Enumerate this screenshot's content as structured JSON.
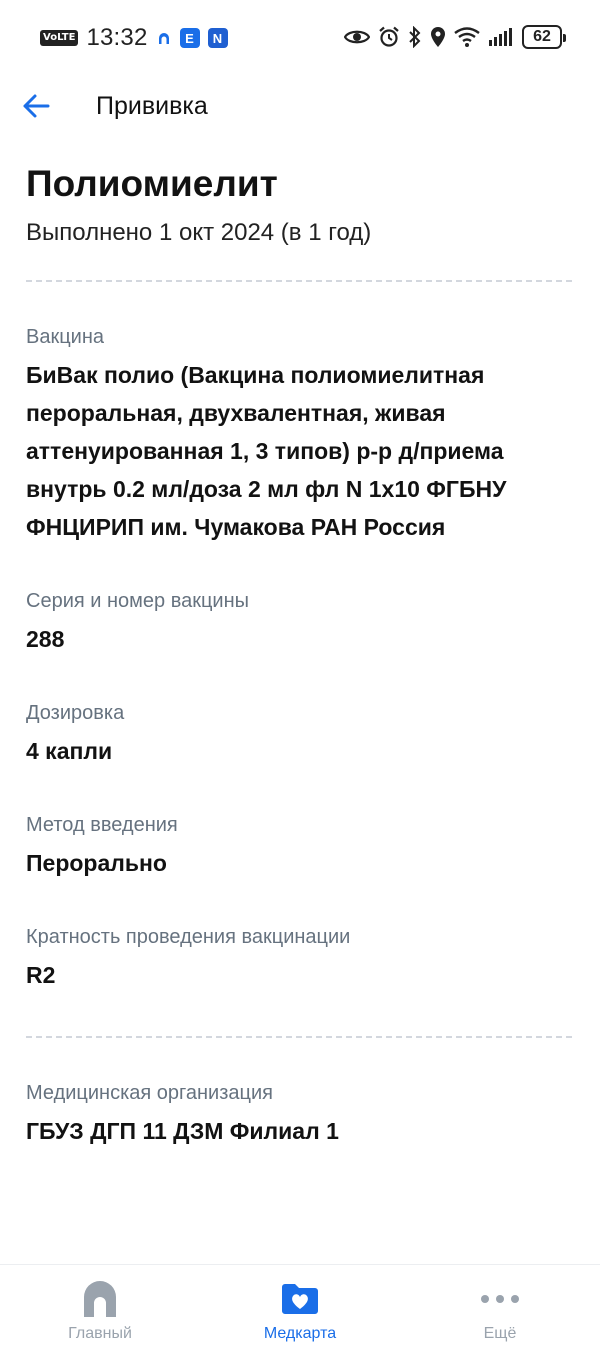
{
  "status_bar": {
    "volte": "VoLTE",
    "time": "13:32",
    "app_e": "E",
    "app_n": "N",
    "battery": "62"
  },
  "topbar": {
    "title": "Прививка"
  },
  "vaccination": {
    "title": "Полиомиелит",
    "subtitle": "Выполнено 1 окт 2024 (в 1 год)",
    "fields": [
      {
        "label": "Вакцина",
        "value": "БиВак полио (Вакцина полиомиелитная пероральная, двухвалентная, живая аттенуированная 1, 3 типов) р-р д/приема внутрь 0.2 мл/доза 2 мл фл N 1x10 ФГБНУ ФНЦИРИП им. Чумакова РАН Россия"
      },
      {
        "label": "Серия и номер вакцины",
        "value": "288"
      },
      {
        "label": "Дозировка",
        "value": "4 капли"
      },
      {
        "label": "Метод введения",
        "value": "Перорально"
      },
      {
        "label": "Кратность проведения вакцинации",
        "value": "R2"
      }
    ],
    "organization": {
      "label": "Медицинская организация",
      "value": "ГБУЗ ДГП 11 ДЗМ Филиал 1"
    }
  },
  "bottom_nav": {
    "items": [
      {
        "label": "Главный",
        "icon": "home-icon",
        "active": false
      },
      {
        "label": "Медкарта",
        "icon": "medcard-folder-heart-icon",
        "active": true
      },
      {
        "label": "Ещё",
        "icon": "more-dots-icon",
        "active": false
      }
    ]
  },
  "colors": {
    "accent": "#1a6ee8",
    "inactive": "#9aa3ad",
    "label": "#66727f",
    "text": "#121212"
  }
}
